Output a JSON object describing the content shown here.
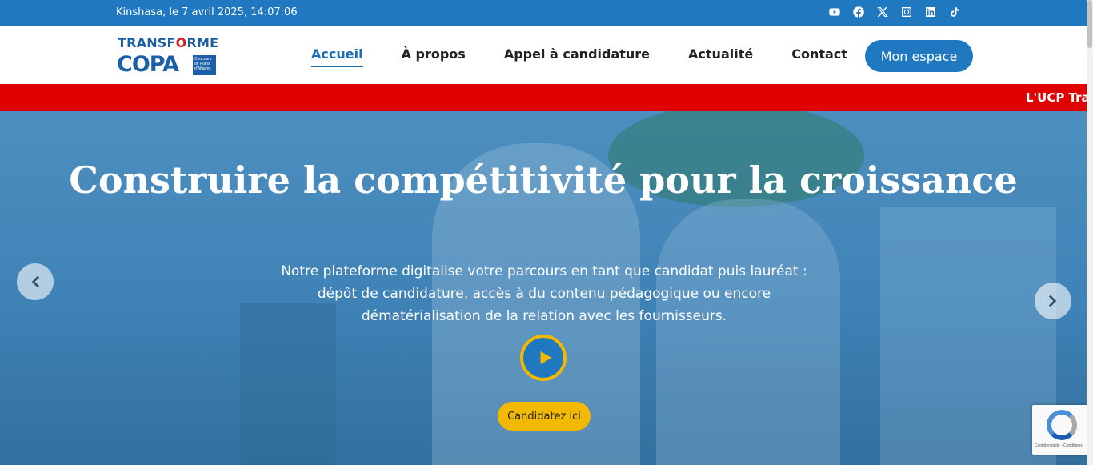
{
  "topbar": {
    "datetime": "Kinshasa, le 7 avril 2025, 14:07:06",
    "social_icons": [
      "youtube-icon",
      "facebook-icon",
      "x-icon",
      "instagram-icon",
      "linkedin-icon",
      "tiktok-icon"
    ]
  },
  "logo": {
    "line1_a": "TRANSF",
    "line1_o": "O",
    "line1_b": "RME",
    "line2": "COPA",
    "badge": "Concours de Plans d'Affaires"
  },
  "nav": {
    "items": [
      {
        "label": "Accueil",
        "active": true
      },
      {
        "label": "À propos"
      },
      {
        "label": "Appel à candidature"
      },
      {
        "label": "Actualité"
      },
      {
        "label": "Contact"
      }
    ],
    "account_button": "Mon espace"
  },
  "ticker": {
    "text": "L'UCP Tran"
  },
  "hero": {
    "title": "Construire la compétitivité pour la croissance",
    "subtitle": "Notre plateforme digitalise votre parcours en tant que candidat puis lauréat : dépôt de candidature, accès à du contenu pédagogique ou encore dématérialisation de la relation avec les fournisseurs.",
    "cta": "Candidatez ici"
  },
  "recaptcha": {
    "text": "Confidentialité - Conditions"
  },
  "colors": {
    "primary": "#1f78c0",
    "ticker": "#e10000",
    "accent": "#f3b800"
  }
}
